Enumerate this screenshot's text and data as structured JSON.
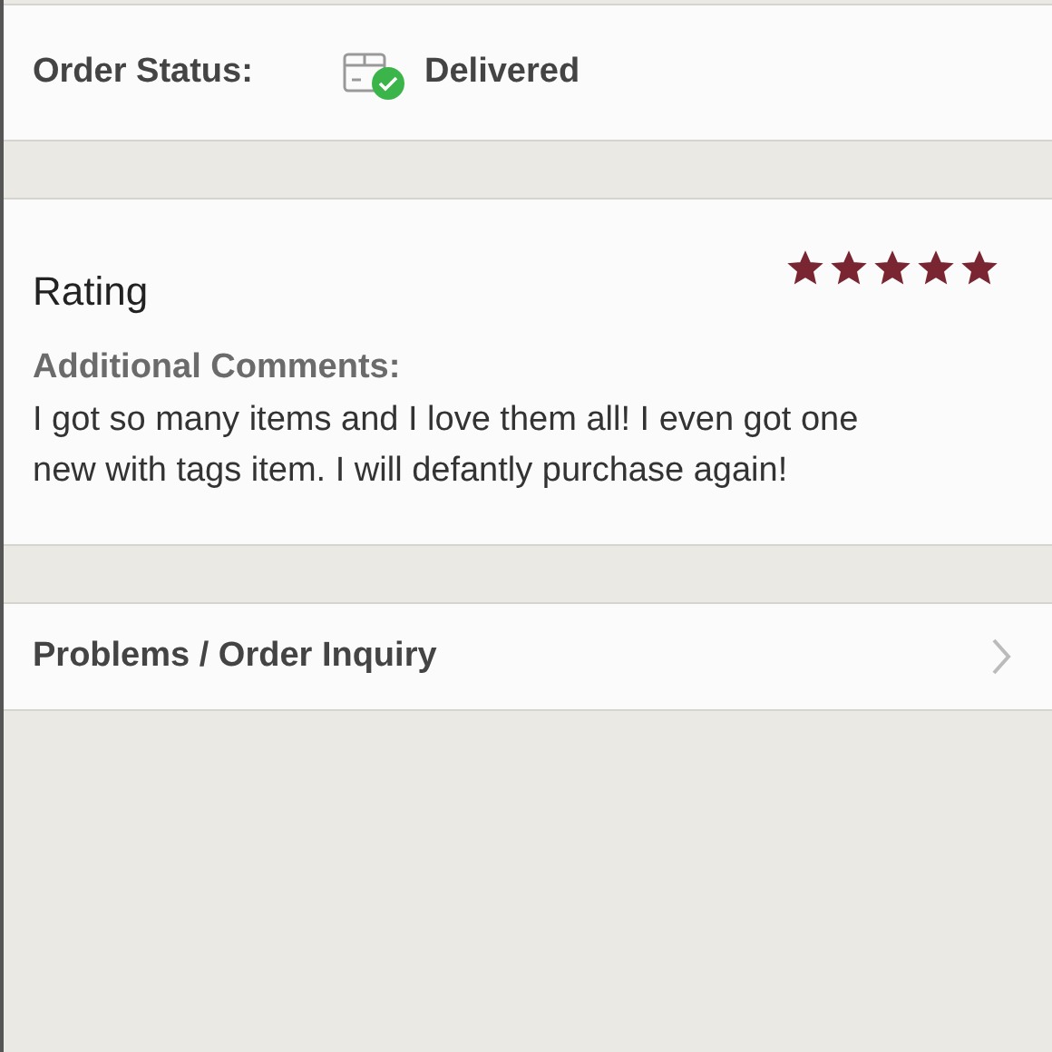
{
  "order_status": {
    "label": "Order Status:",
    "value": "Delivered"
  },
  "rating": {
    "title": "Rating",
    "stars": 5,
    "comments_label": "Additional Comments:",
    "comments": "I got so many items and I love them all! I even got one new with tags item. I will defantly purchase again!"
  },
  "inquiry": {
    "label": "Problems / Order Inquiry"
  }
}
